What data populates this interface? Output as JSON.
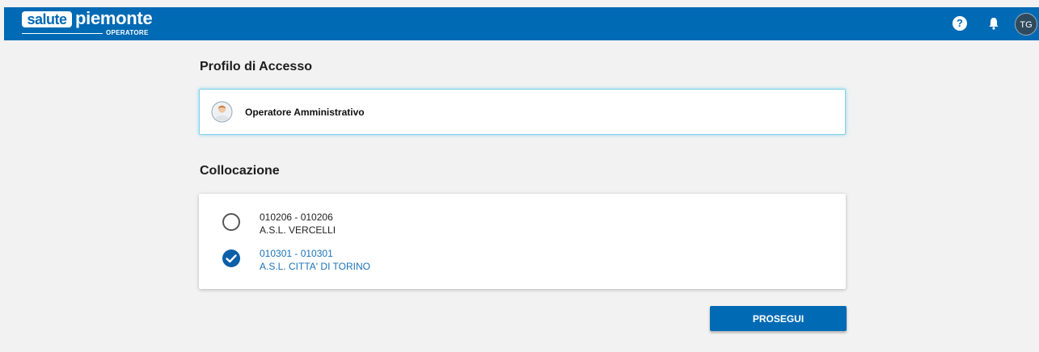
{
  "header": {
    "logo_box_text": "salute",
    "logo_word": "piemonte",
    "logo_sub": "OPERATORE",
    "help_icon": "?",
    "user_initials": "TG",
    "colors": {
      "brand": "#006ab4"
    }
  },
  "profilo": {
    "title": "Profilo di Accesso",
    "selected_label": "Operatore Amministrativo",
    "icon": "person-avatar-icon"
  },
  "collocazione": {
    "title": "Collocazione",
    "options": [
      {
        "code": "010206 - 010206",
        "name": "A.S.L. VERCELLI",
        "selected": false
      },
      {
        "code": "010301 - 010301",
        "name": "A.S.L. CITTA' DI TORINO",
        "selected": true
      }
    ]
  },
  "actions": {
    "continue_label": "PROSEGUI"
  }
}
